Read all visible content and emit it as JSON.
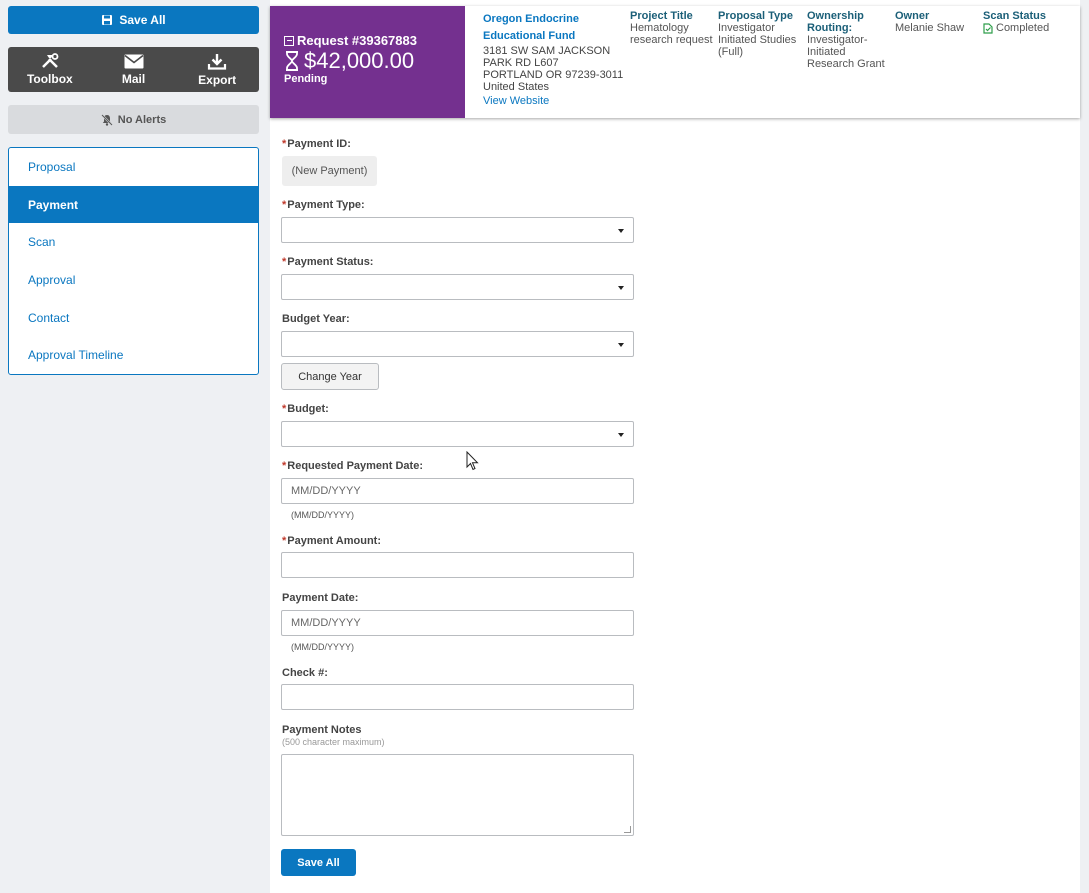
{
  "sidebar": {
    "save_all_label": "Save All",
    "toolbar": [
      {
        "label": "Toolbox",
        "icon": "tools-icon"
      },
      {
        "label": "Mail",
        "icon": "mail-icon"
      },
      {
        "label": "Export",
        "icon": "download-icon"
      }
    ],
    "alerts_label": "No Alerts",
    "nav": [
      {
        "label": "Proposal",
        "active": false
      },
      {
        "label": "Payment",
        "active": true
      },
      {
        "label": "Scan",
        "active": false
      },
      {
        "label": "Approval",
        "active": false
      },
      {
        "label": "Contact",
        "active": false
      },
      {
        "label": "Approval Timeline",
        "active": false
      }
    ]
  },
  "header": {
    "request_id": "Request #39367883",
    "amount": "$42,000.00",
    "status": "Pending",
    "org": {
      "name": "Oregon Endocrine Educational Fund",
      "address_1": "3181 SW SAM JACKSON PARK RD L607",
      "address_2": "PORTLAND OR 97239-3011",
      "country": "United States",
      "website_link": "View Website"
    },
    "columns": {
      "project_title": {
        "heading": "Project Title",
        "value": "Hematology research request"
      },
      "proposal_type": {
        "heading": "Proposal Type",
        "value": "Investigator Initiated Studies (Full)"
      },
      "ownership_routing": {
        "heading": "Ownership Routing:",
        "value": "Investigator-Initiated Research Grant"
      },
      "owner": {
        "heading": "Owner",
        "value": "Melanie Shaw"
      },
      "scan_status": {
        "heading": "Scan Status",
        "value": "Completed"
      }
    },
    "colors": {
      "banner": "#74308f",
      "accent": "#0a77c0",
      "heading": "#1b5f78"
    }
  },
  "form": {
    "payment_id": {
      "label": "Payment ID:",
      "value": "(New Payment)",
      "required": true
    },
    "payment_type": {
      "label": "Payment Type:",
      "value": "",
      "required": true
    },
    "payment_status": {
      "label": "Payment Status:",
      "value": "",
      "required": true
    },
    "budget_year": {
      "label": "Budget Year:",
      "value": "",
      "required": false
    },
    "change_year_label": "Change Year",
    "budget": {
      "label": "Budget:",
      "value": "",
      "required": true
    },
    "requested_payment_date": {
      "label": "Requested Payment Date:",
      "placeholder": "MM/DD/YYYY",
      "hint": "(MM/DD/YYYY)",
      "required": true
    },
    "payment_amount": {
      "label": "Payment Amount:",
      "value": "",
      "required": true
    },
    "payment_date": {
      "label": "Payment Date:",
      "placeholder": "MM/DD/YYYY",
      "hint": "(MM/DD/YYYY)",
      "required": false
    },
    "check_number": {
      "label": "Check #:",
      "value": "",
      "required": false
    },
    "payment_notes": {
      "label": "Payment Notes",
      "sublabel": "(500 character maximum)",
      "value": ""
    },
    "save_all_label": "Save All"
  },
  "required_marker": "*"
}
